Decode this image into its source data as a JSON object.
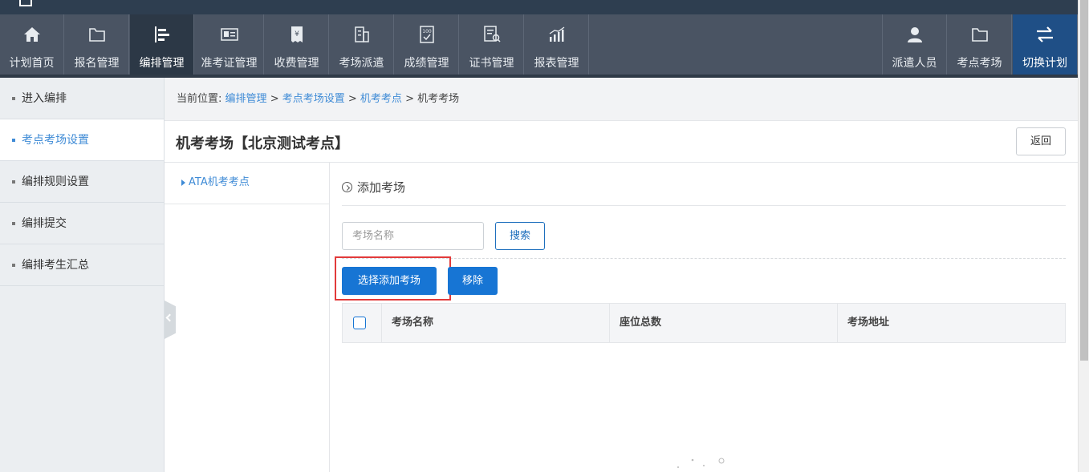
{
  "topnav": {
    "items": [
      {
        "label": "计划首页",
        "icon": "home-icon"
      },
      {
        "label": "报名管理",
        "icon": "folder-icon"
      },
      {
        "label": "编排管理",
        "icon": "schedule-icon"
      },
      {
        "label": "准考证管理",
        "icon": "id-card-icon"
      },
      {
        "label": "收费管理",
        "icon": "yen-receipt-icon"
      },
      {
        "label": "考场派遣",
        "icon": "building-icon"
      },
      {
        "label": "成绩管理",
        "icon": "score-icon"
      },
      {
        "label": "证书管理",
        "icon": "certificate-icon"
      },
      {
        "label": "报表管理",
        "icon": "chart-icon"
      }
    ],
    "right_items": [
      {
        "label": "派遣人员",
        "icon": "person-icon"
      },
      {
        "label": "考点考场",
        "icon": "folder-icon"
      },
      {
        "label": "切换计划",
        "icon": "switch-arrows-icon"
      }
    ],
    "active_color": "#2c3846",
    "switch_color": "#1f4f86"
  },
  "sidebar": {
    "items": [
      {
        "label": "进入编排"
      },
      {
        "label": "考点考场设置"
      },
      {
        "label": "编排规则设置"
      },
      {
        "label": "编排提交"
      },
      {
        "label": "编排考生汇总"
      }
    ]
  },
  "breadcrumb": {
    "prefix": "当前位置:",
    "links": [
      "编排管理",
      "考点考场设置",
      "机考考点"
    ],
    "current": "机考考场",
    "sep": " > "
  },
  "title": "机考考场【北京测试考点】",
  "back_label": "返回",
  "tree": {
    "item": "ATA机考考点"
  },
  "main": {
    "add_label": "添加考场",
    "search_placeholder": "考场名称",
    "search_label": "搜索",
    "add_select_label": "选择添加考场",
    "remove_label": "移除"
  },
  "table": {
    "headers": [
      "考场名称",
      "座位总数",
      "考场地址"
    ]
  },
  "colors": {
    "primary": "#1775d4",
    "link": "#3f8bd6",
    "highlight": "#e23a3a"
  }
}
